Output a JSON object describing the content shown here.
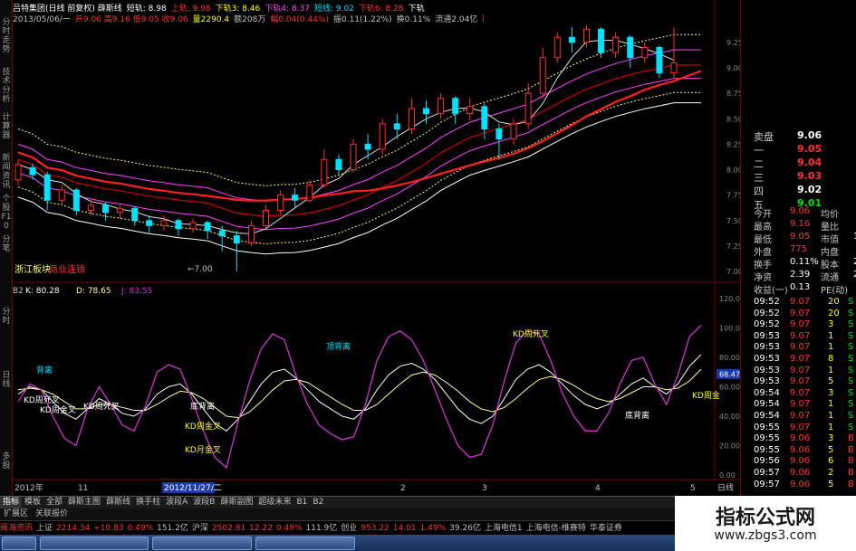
{
  "left_tabs": [
    "分时走势",
    "技术分析",
    "计算器",
    "新闻资讯",
    "个股F10",
    "分笔",
    "分时",
    "日线",
    "多股"
  ],
  "header1": [
    {
      "t": "吕特集团(日线 前复权) 薛斯线",
      "c": "#ffffff"
    },
    {
      "t": "短轨: 8.98",
      "c": "#ffffff"
    },
    {
      "t": "上轨: 9.98",
      "c": "#ff3030"
    },
    {
      "t": "下轨3: 8.46",
      "c": "#ffff00"
    },
    {
      "t": "下轨4: 8.37",
      "c": "#ff40ff"
    },
    {
      "t": "短线: 9.02",
      "c": "#00e0ff"
    },
    {
      "t": "下轨6: 8.28",
      "c": "#ff3030"
    },
    {
      "t": "下轨",
      "c": "#ffffff"
    }
  ],
  "header2": [
    {
      "t": "2013/05/06/一",
      "c": "#c0c0c0"
    },
    {
      "t": "开9.06 高9.16 低9.05 收9.06",
      "c": "#ff3030"
    },
    {
      "t": "量2290.4",
      "c": "#ffff00"
    },
    {
      "t": "额208万",
      "c": "#c0c0c0"
    },
    {
      "t": "幅0.04(0.44%)",
      "c": "#ff3030"
    },
    {
      "t": "振0.11(1.22%)",
      "c": "#c0c0c0"
    },
    {
      "t": "换0.11%",
      "c": "#c0c0c0"
    },
    {
      "t": "流通2.04亿",
      "c": "#c0c0c0"
    },
    {
      "t": "医药连锁",
      "c": "#ff3030"
    }
  ],
  "main_labels": {
    "sector": "浙江板块",
    "concept": "商业连锁",
    "low_marker": "←7.00"
  },
  "kdj_header": {
    "name": "B2",
    "k": "K: 80.28",
    "d": "D: 78.65",
    "j": "J: 83.55"
  },
  "annotations": [
    {
      "t": "背离",
      "c": "#00e0ff"
    },
    {
      "t": "KD周死叉",
      "c": "#ffffff"
    },
    {
      "t": "KD周金叉",
      "c": "#ffffff"
    },
    {
      "t": "KD周死叉",
      "c": "#ffffff"
    },
    {
      "t": "底背离",
      "c": "#ffffff"
    },
    {
      "t": "KD周金叉",
      "c": "#ffff00"
    },
    {
      "t": "KD月金叉",
      "c": "#ffff00"
    },
    {
      "t": "顶背离",
      "c": "#00e0ff"
    },
    {
      "t": "KD周死叉",
      "c": "#ffff00"
    },
    {
      "t": "底背离",
      "c": "#ffffff"
    },
    {
      "t": "KD周金",
      "c": "#ffff00"
    }
  ],
  "price_axis": [
    "9.25",
    "9.00",
    "8.75",
    "8.50",
    "8.25",
    "8.00",
    "7.75",
    "7.50",
    "7.25",
    "7.00"
  ],
  "kdj_axis": [
    "120.00",
    "100.00",
    "80.00",
    "68.47",
    "60.00",
    "40.00",
    "20.00",
    "0.00"
  ],
  "date_axis": {
    "d1": "2012年",
    "d2": "11",
    "d3": "2012/11/27/二",
    "d4": "2",
    "d5": "3",
    "d6": "4",
    "d7": "5",
    "d8": "日线"
  },
  "order_book": [
    {
      "label": "卖盘",
      "price": "9.06",
      "color": "#ffffff"
    },
    {
      "label": "一",
      "price": "9.05",
      "color": "#ff3030"
    },
    {
      "label": "二",
      "price": "9.04",
      "color": "#ff3030"
    },
    {
      "label": "三",
      "price": "9.03",
      "color": "#ff3030"
    },
    {
      "label": "四",
      "price": "9.02",
      "color": "#ffffff"
    },
    {
      "label": "五",
      "price": "9.01",
      "color": "#00e000"
    }
  ],
  "stats": [
    {
      "a": "今开",
      "b": "9.06",
      "bc": "#ff3030",
      "c": "均价",
      "d": ""
    },
    {
      "a": "最高",
      "b": "9.16",
      "bc": "#ff3030",
      "c": "量比",
      "d": ""
    },
    {
      "a": "最低",
      "b": "9.05",
      "bc": "#ff3030",
      "c": "市值",
      "d": "18"
    },
    {
      "a": "外盘",
      "b": "775",
      "bc": "#ff3030",
      "c": "内盘",
      "d": ""
    },
    {
      "a": "换手",
      "b": "0.11%",
      "bc": "#ffffff",
      "c": "股本",
      "d": "2"
    },
    {
      "a": "净资",
      "b": "2.39",
      "bc": "#ffffff",
      "c": "流通",
      "d": "2"
    },
    {
      "a": "收益(一)",
      "b": "0.13",
      "bc": "#ffffff",
      "c": "PE(动)",
      "d": ""
    }
  ],
  "ticks": [
    {
      "time": "09:52",
      "price": "9.07",
      "vol": "20",
      "flag": "S"
    },
    {
      "time": "09:52",
      "price": "9.07",
      "vol": "20",
      "flag": "S"
    },
    {
      "time": "09:52",
      "price": "9.07",
      "vol": "3",
      "flag": "S"
    },
    {
      "time": "09:53",
      "price": "9.07",
      "vol": "1",
      "flag": "S"
    },
    {
      "time": "09:53",
      "price": "9.07",
      "vol": "1",
      "flag": "S"
    },
    {
      "time": "09:53",
      "price": "9.07",
      "vol": "8",
      "flag": "S"
    },
    {
      "time": "09:53",
      "price": "9.07",
      "vol": "1",
      "flag": "S"
    },
    {
      "time": "09:53",
      "price": "9.07",
      "vol": "5",
      "flag": "S"
    },
    {
      "time": "09:54",
      "price": "9.07",
      "vol": "3",
      "flag": "S"
    },
    {
      "time": "09:54",
      "price": "9.07",
      "vol": "1",
      "flag": "S"
    },
    {
      "time": "09:54",
      "price": "9.07",
      "vol": "1",
      "flag": "S"
    },
    {
      "time": "09:55",
      "price": "9.07",
      "vol": "1",
      "flag": "S"
    },
    {
      "time": "09:55",
      "price": "9.06",
      "vol": "3",
      "flag": "B"
    },
    {
      "time": "09:55",
      "price": "9.06",
      "vol": "5",
      "flag": "B"
    },
    {
      "time": "09:56",
      "price": "9.06",
      "vol": "6",
      "flag": "B"
    },
    {
      "time": "09:57",
      "price": "9.06",
      "vol": "2",
      "flag": "B"
    },
    {
      "time": "09:57",
      "price": "9.06",
      "vol": "5",
      "flag": "B"
    }
  ],
  "bottom_tabs": [
    "指标",
    "模板",
    "全部",
    "薛斯主图",
    "薛斯线",
    "换手柱",
    "波段A",
    "波段B",
    "薛斯副图",
    "超级未来",
    "B1",
    "B2"
  ],
  "sub_tabs": [
    "扩展区",
    "关联报价"
  ],
  "ticker": [
    {
      "t": "闽海资讯",
      "c": "#ff3030"
    },
    {
      "t": "上证",
      "c": "#c0c0c0"
    },
    {
      "t": "2214.34",
      "c": "#ff3030"
    },
    {
      "t": "+10.83",
      "c": "#ff3030"
    },
    {
      "t": "0.49%",
      "c": "#ff3030"
    },
    {
      "t": "151.2亿",
      "c": "#c0c0c0"
    },
    {
      "t": "沪深",
      "c": "#c0c0c0"
    },
    {
      "t": "2502.81",
      "c": "#ff3030"
    },
    {
      "t": "12.22",
      "c": "#ff3030"
    },
    {
      "t": "0.49%",
      "c": "#ff3030"
    },
    {
      "t": "111.9亿",
      "c": "#c0c0c0"
    },
    {
      "t": "创业",
      "c": "#c0c0c0"
    },
    {
      "t": "953.22",
      "c": "#ff3030"
    },
    {
      "t": "14.01",
      "c": "#ff3030"
    },
    {
      "t": "1.49%",
      "c": "#ff3030"
    },
    {
      "t": "39.26亿",
      "c": "#c0c0c0"
    },
    {
      "t": "上海电信1",
      "c": "#c0c0c0"
    },
    {
      "t": "上海电信-维赛特",
      "c": "#c0c0c0"
    },
    {
      "t": "华泰证券",
      "c": "#c0c0c0"
    }
  ],
  "watermark": {
    "title": "指标公式网",
    "url": "www.zbgs3.com"
  },
  "colors": {
    "up": "#ff3030",
    "down": "#00e0ff",
    "k": "#ffffff",
    "d": "#ffff99",
    "j": "#cc33cc"
  },
  "chart_data": [
    {
      "type": "candlestick",
      "title": "",
      "ylim": [
        7.0,
        9.4
      ],
      "ylabel": "",
      "candles": [
        {
          "o": 7.9,
          "c": 8.05,
          "h": 8.1,
          "l": 7.85
        },
        {
          "o": 8.02,
          "c": 7.95,
          "h": 8.06,
          "l": 7.9
        },
        {
          "o": 7.95,
          "c": 7.7,
          "h": 7.98,
          "l": 7.6
        },
        {
          "o": 7.7,
          "c": 7.8,
          "h": 7.85,
          "l": 7.65
        },
        {
          "o": 7.8,
          "c": 7.6,
          "h": 7.82,
          "l": 7.55
        },
        {
          "o": 7.6,
          "c": 7.65,
          "h": 7.7,
          "l": 7.55
        },
        {
          "o": 7.65,
          "c": 7.58,
          "h": 7.68,
          "l": 7.5
        },
        {
          "o": 7.58,
          "c": 7.62,
          "h": 7.66,
          "l": 7.52
        },
        {
          "o": 7.62,
          "c": 7.5,
          "h": 7.64,
          "l": 7.45
        },
        {
          "o": 7.5,
          "c": 7.45,
          "h": 7.55,
          "l": 7.38
        },
        {
          "o": 7.45,
          "c": 7.5,
          "h": 7.55,
          "l": 7.4
        },
        {
          "o": 7.5,
          "c": 7.42,
          "h": 7.52,
          "l": 7.35
        },
        {
          "o": 7.42,
          "c": 7.48,
          "h": 7.52,
          "l": 7.38
        },
        {
          "o": 7.48,
          "c": 7.4,
          "h": 7.5,
          "l": 7.32
        },
        {
          "o": 7.4,
          "c": 7.35,
          "h": 7.45,
          "l": 7.2
        },
        {
          "o": 7.35,
          "c": 7.28,
          "h": 7.4,
          "l": 7.0
        },
        {
          "o": 7.28,
          "c": 7.45,
          "h": 7.5,
          "l": 7.25
        },
        {
          "o": 7.45,
          "c": 7.6,
          "h": 7.65,
          "l": 7.42
        },
        {
          "o": 7.6,
          "c": 7.75,
          "h": 7.8,
          "l": 7.55
        },
        {
          "o": 7.75,
          "c": 7.7,
          "h": 7.82,
          "l": 7.62
        },
        {
          "o": 7.7,
          "c": 7.85,
          "h": 7.9,
          "l": 7.68
        },
        {
          "o": 7.85,
          "c": 8.1,
          "h": 8.2,
          "l": 7.82
        },
        {
          "o": 8.1,
          "c": 8.0,
          "h": 8.15,
          "l": 7.95
        },
        {
          "o": 8.0,
          "c": 8.25,
          "h": 8.3,
          "l": 7.98
        },
        {
          "o": 8.25,
          "c": 8.2,
          "h": 8.35,
          "l": 8.1
        },
        {
          "o": 8.2,
          "c": 8.45,
          "h": 8.5,
          "l": 8.15
        },
        {
          "o": 8.45,
          "c": 8.4,
          "h": 8.55,
          "l": 8.3
        },
        {
          "o": 8.4,
          "c": 8.6,
          "h": 8.7,
          "l": 8.35
        },
        {
          "o": 8.6,
          "c": 8.55,
          "h": 8.68,
          "l": 8.45
        },
        {
          "o": 8.55,
          "c": 8.7,
          "h": 8.75,
          "l": 8.5
        },
        {
          "o": 8.7,
          "c": 8.55,
          "h": 8.72,
          "l": 8.45
        },
        {
          "o": 8.55,
          "c": 8.62,
          "h": 8.7,
          "l": 8.48
        },
        {
          "o": 8.62,
          "c": 8.4,
          "h": 8.65,
          "l": 8.3
        },
        {
          "o": 8.4,
          "c": 8.3,
          "h": 8.45,
          "l": 8.1
        },
        {
          "o": 8.3,
          "c": 8.45,
          "h": 8.5,
          "l": 8.25
        },
        {
          "o": 8.45,
          "c": 8.75,
          "h": 8.85,
          "l": 8.4
        },
        {
          "o": 8.75,
          "c": 9.1,
          "h": 9.2,
          "l": 8.7
        },
        {
          "o": 9.1,
          "c": 9.3,
          "h": 9.35,
          "l": 9.05
        },
        {
          "o": 9.3,
          "c": 9.25,
          "h": 9.4,
          "l": 9.15
        },
        {
          "o": 9.25,
          "c": 9.38,
          "h": 9.42,
          "l": 9.2
        },
        {
          "o": 9.38,
          "c": 9.15,
          "h": 9.4,
          "l": 9.1
        },
        {
          "o": 9.15,
          "c": 9.3,
          "h": 9.35,
          "l": 9.1
        },
        {
          "o": 9.3,
          "c": 9.1,
          "h": 9.32,
          "l": 9.0
        },
        {
          "o": 9.1,
          "c": 9.2,
          "h": 9.25,
          "l": 9.05
        },
        {
          "o": 9.2,
          "c": 8.95,
          "h": 9.22,
          "l": 8.9
        },
        {
          "o": 8.95,
          "c": 9.05,
          "h": 9.4,
          "l": 8.9
        }
      ]
    },
    {
      "type": "line",
      "title": "",
      "ylim": [
        0,
        120
      ],
      "x_count": 60,
      "series": [
        {
          "name": "K",
          "values": [
            55,
            60,
            58,
            50,
            42,
            38,
            45,
            52,
            48,
            42,
            40,
            45,
            55,
            60,
            62,
            55,
            45,
            35,
            30,
            38,
            50,
            62,
            70,
            72,
            66,
            58,
            50,
            45,
            40,
            38,
            45,
            58,
            68,
            74,
            76,
            72,
            65,
            55,
            45,
            38,
            35,
            40,
            52,
            65,
            72,
            75,
            70,
            62,
            54,
            48,
            45,
            48,
            55,
            62,
            66,
            60,
            55,
            62,
            74,
            82
          ]
        },
        {
          "name": "D",
          "values": [
            58,
            59,
            58,
            55,
            50,
            45,
            45,
            48,
            48,
            46,
            44,
            44,
            48,
            53,
            57,
            56,
            52,
            46,
            40,
            39,
            43,
            50,
            58,
            64,
            65,
            63,
            58,
            53,
            48,
            44,
            44,
            48,
            55,
            62,
            68,
            70,
            68,
            63,
            57,
            50,
            45,
            43,
            46,
            52,
            59,
            65,
            67,
            65,
            61,
            56,
            52,
            50,
            52,
            56,
            60,
            60,
            58,
            59,
            64,
            72
          ]
        },
        {
          "name": "J",
          "values": [
            50,
            62,
            58,
            40,
            25,
            20,
            45,
            60,
            48,
            34,
            30,
            47,
            70,
            75,
            72,
            52,
            30,
            12,
            5,
            36,
            64,
            86,
            96,
            92,
            68,
            48,
            34,
            28,
            24,
            26,
            48,
            78,
            94,
            98,
            92,
            78,
            58,
            38,
            20,
            12,
            14,
            34,
            64,
            90,
            98,
            96,
            78,
            56,
            40,
            30,
            30,
            42,
            62,
            78,
            80,
            62,
            48,
            68,
            94,
            102
          ]
        }
      ]
    }
  ]
}
